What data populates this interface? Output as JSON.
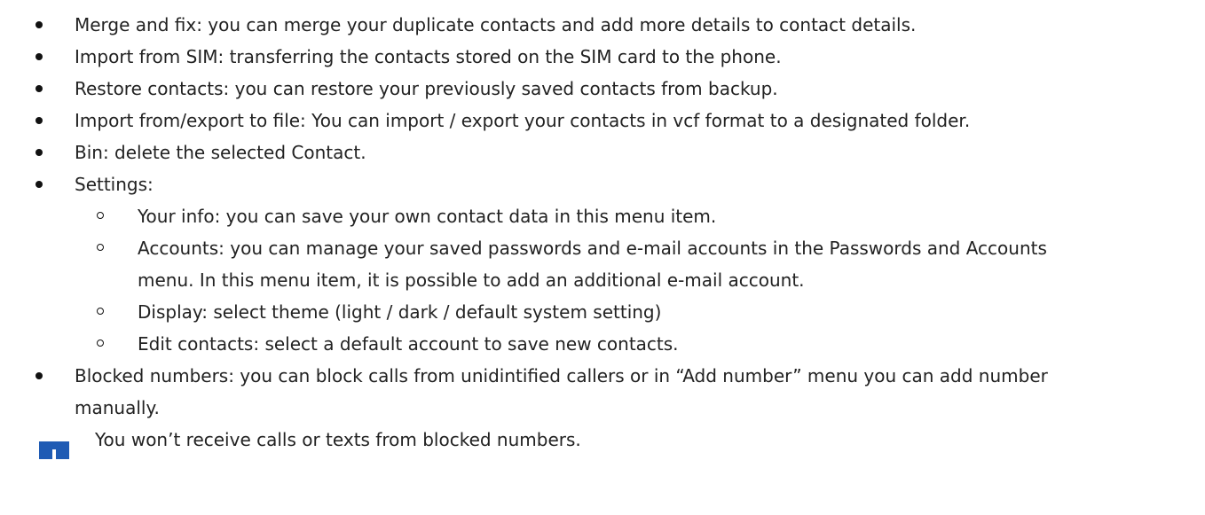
{
  "items": [
    {
      "text": "Merge and fix: you can merge your duplicate contacts and add more details to contact details."
    },
    {
      "text": "Import from SIM: transferring the contacts stored on the SIM card to the phone."
    },
    {
      "text": "Restore contacts: you can restore your previously saved contacts from backup."
    },
    {
      "text": "Import from/export to file: You can import / export your contacts in vcf format to a designated folder."
    },
    {
      "text": "Bin: delete the selected Contact."
    },
    {
      "text": "Settings:"
    }
  ],
  "settings_items": [
    {
      "text": "Your info: you can save your own contact data in this menu item."
    },
    {
      "line1": "Accounts: you can manage your saved passwords and e-mail accounts in the Passwords and Accounts",
      "line2": "menu. In this menu item, it is possible to add an additional e-mail account."
    },
    {
      "text": "Display: select theme (light / dark / default system setting)"
    },
    {
      "text": "Edit contacts: select a default account to save new contacts."
    }
  ],
  "blocked": {
    "line1": "Blocked numbers: you can block calls from unidintified callers or in “Add number” menu you can add number",
    "line2": "manually."
  },
  "note": {
    "icon": "info-icon",
    "text": "You won’t receive calls or texts from blocked numbers.",
    "icon_color": "#1f5bb4"
  }
}
